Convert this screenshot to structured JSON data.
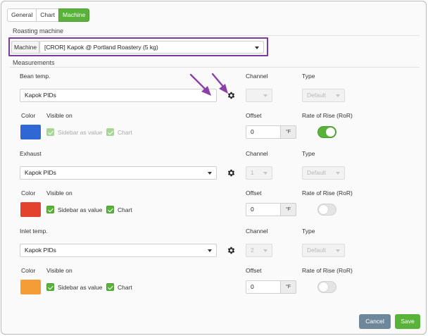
{
  "tabs": [
    {
      "label": "General"
    },
    {
      "label": "Chart"
    },
    {
      "label": "Machine"
    }
  ],
  "roasting_machine": {
    "heading": "Roasting machine",
    "machine_label": "Machine",
    "machine_value": "[CROR] Kapok  @ Portland Roastery (5 kg)"
  },
  "measurements": {
    "heading": "Measurements",
    "column_labels": {
      "channel": "Channel",
      "type": "Type",
      "color": "Color",
      "visible_on": "Visible on",
      "offset": "Offset",
      "ror": "Rate of Rise (RoR)"
    },
    "sidebar_label": "Sidebar as value",
    "chart_label": "Chart",
    "items": [
      {
        "name": "Bean temp.",
        "source": "Kapok PIDs",
        "channel": "",
        "type": "Default",
        "color": "#2f67d4",
        "sidebar_checked": true,
        "chart_checked": true,
        "checkbox_disabled": true,
        "offset": "0",
        "unit": "°F",
        "ror_on": true
      },
      {
        "name": "Exhaust",
        "source": "Kapok PIDs",
        "channel": "1",
        "type": "Default",
        "color": "#e3422c",
        "sidebar_checked": true,
        "chart_checked": true,
        "checkbox_disabled": false,
        "offset": "0",
        "unit": "°F",
        "ror_on": false
      },
      {
        "name": "Inlet temp.",
        "source": "Kapok PIDs",
        "channel": "2",
        "type": "Default",
        "color": "#f49c36",
        "sidebar_checked": true,
        "chart_checked": true,
        "checkbox_disabled": false,
        "offset": "0",
        "unit": "°F",
        "ror_on": false
      }
    ]
  },
  "footer": {
    "cancel_label": "Cancel",
    "save_label": "Save"
  },
  "colors": {
    "accent_green": "#59b33a",
    "highlight_purple": "#7c3a9e",
    "cancel_gray": "#6f879a"
  },
  "icons": {
    "gear": "gear-icon",
    "annotation": "arrow-annotation"
  }
}
